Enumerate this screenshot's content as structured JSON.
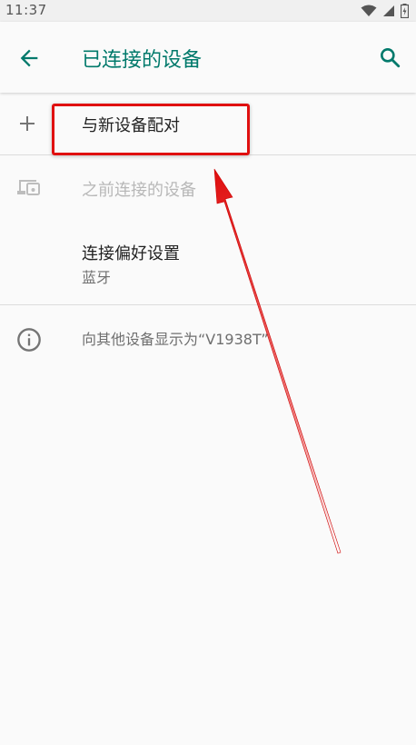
{
  "status": {
    "time": "11:37"
  },
  "appbar": {
    "title": "已连接的设备"
  },
  "items": {
    "pair_new": "与新设备配对",
    "previously_connected": "之前连接的设备",
    "preferences_title": "连接偏好设置",
    "preferences_subtitle": "蓝牙",
    "visible_as": "向其他设备显示为“V1938T”"
  },
  "colors": {
    "accent": "#00796b",
    "annotation": "#e01010"
  }
}
